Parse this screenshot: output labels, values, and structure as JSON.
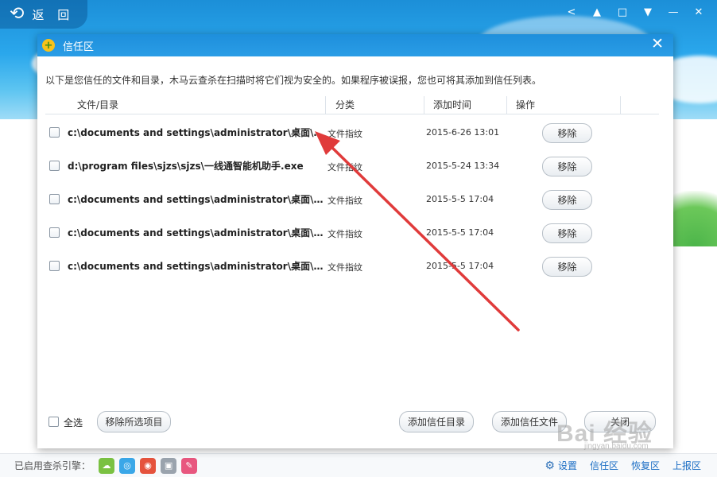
{
  "app": {
    "back_label": "返 回",
    "top_icons": [
      "share-icon",
      "skin-icon",
      "message-icon",
      "menu-icon",
      "minimize-icon",
      "close-icon"
    ]
  },
  "dialog": {
    "title": "信任区",
    "close_glyph": "✕",
    "description": "以下是您信任的文件和目录，木马云查杀在扫描时将它们视为安全的。如果程序被误报，您也可将其添加到信任列表。",
    "columns": [
      "文件/目录",
      "分类",
      "添加时间",
      "操作"
    ],
    "rows": [
      {
        "path": "c:\\documents and settings\\administrator\\桌面\\敞...",
        "category": "文件指纹",
        "time": "2015-6-26 13:01",
        "action": "移除"
      },
      {
        "path": "d:\\program files\\sjzs\\sjzs\\一线通智能机助手.exe",
        "category": "文件指纹",
        "time": "2015-5-24 13:34",
        "action": "移除"
      },
      {
        "path": "c:\\documents and settings\\administrator\\桌面\\新...",
        "category": "文件指纹",
        "time": "2015-5-5 17:04",
        "action": "移除"
      },
      {
        "path": "c:\\documents and settings\\administrator\\桌面\\新...",
        "category": "文件指纹",
        "time": "2015-5-5 17:04",
        "action": "移除"
      },
      {
        "path": "c:\\documents and settings\\administrator\\桌面\\新...",
        "category": "文件指纹",
        "time": "2015-5-5 17:04",
        "action": "移除"
      }
    ],
    "select_all_label": "全选",
    "remove_selected_label": "移除所选项目",
    "add_dir_label": "添加信任目录",
    "add_file_label": "添加信任文件",
    "close_label": "关闭"
  },
  "status_bar": {
    "engines_label": "已启用查杀引擎：",
    "engine_colors": [
      "#7ac142",
      "#3aa7e8",
      "#e5533d",
      "#9aa3ad",
      "#e8577f"
    ],
    "settings_label": "设置",
    "trust_label": "信任区",
    "restore_label": "恢复区",
    "report_label": "上报区"
  },
  "watermark": {
    "text": "Bai 经验",
    "sub": "jingyan.baidu.com"
  }
}
